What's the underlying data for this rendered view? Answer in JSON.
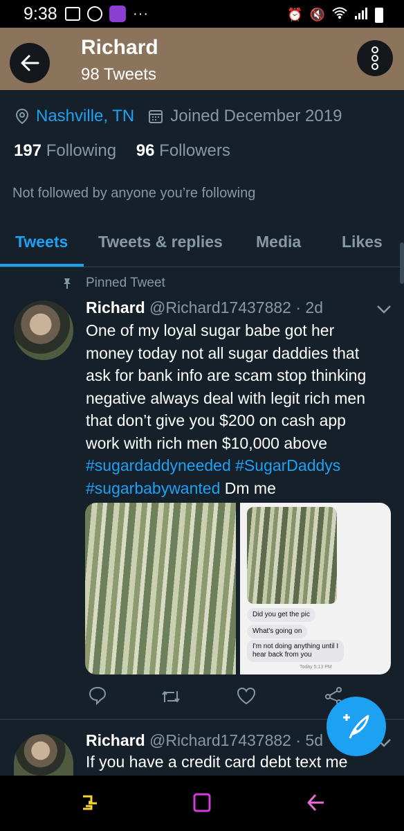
{
  "status_bar": {
    "time": "9:38",
    "icons": [
      "image-icon",
      "instagram-icon",
      "app-icon",
      "more-notifications-icon",
      "alarm-icon",
      "mute-icon",
      "wifi-icon",
      "signal-icon",
      "battery-icon"
    ],
    "more": "···"
  },
  "header": {
    "title": "Richard",
    "subtitle": "98 Tweets",
    "color": "#8c735b"
  },
  "profile": {
    "location": "Nashville, TN",
    "joined": "Joined December 2019",
    "following_count": "197",
    "following_label": "Following",
    "followers_count": "96",
    "followers_label": "Followers",
    "not_followed": "Not followed by anyone you’re following"
  },
  "tabs": [
    {
      "label": "Tweets",
      "active": true
    },
    {
      "label": "Tweets & replies",
      "active": false
    },
    {
      "label": "Media",
      "active": false
    },
    {
      "label": "Likes",
      "active": false
    }
  ],
  "tweets": [
    {
      "pinned_label": "Pinned Tweet",
      "name": "Richard",
      "handle": "@Richard17437882",
      "time": "· 2d",
      "text_lines": [
        "One of my loyal sugar babe got her",
        "money today not all sugar daddies that",
        "ask for bank info are scam stop thinking",
        "negative always deal with legit rich men",
        "that don’t give you $200  on cash app",
        "work with rich men $10,000 above"
      ],
      "hashtag1": "#sugardaddyneeded",
      "hashtag2": "#SugarDaddys",
      "hashtag3": "#sugarbabywanted",
      "tail": " Dm me",
      "chat": {
        "msg1": "Did you get the pic",
        "msg2": "What's going on",
        "msg3_line1": "I'm not doing anything until I",
        "msg3_line2": "hear back from you",
        "timestamp": "Today 5:13 PM"
      }
    },
    {
      "name": "Richard",
      "handle": "@Richard17437882",
      "time": "· 5d",
      "text": "If you have a credit card debt text me"
    }
  ],
  "colors": {
    "background": "#15202b",
    "accent": "#1da1f2",
    "secondary_text": "#8899a6",
    "divider": "#38444d"
  }
}
